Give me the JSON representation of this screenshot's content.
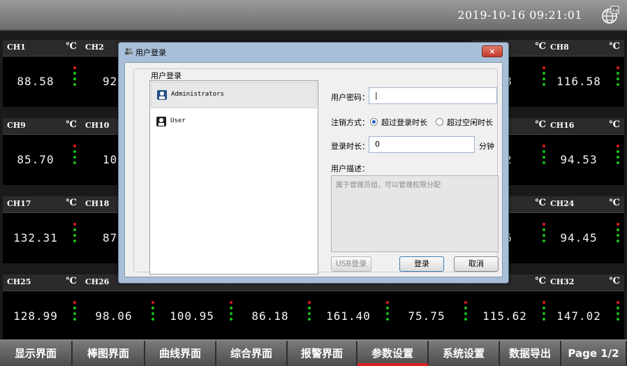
{
  "header": {
    "datetime": "2019-10-16  09:21:01",
    "globe_icon": "globe-icon"
  },
  "unit": "℃",
  "rows": [
    {
      "cells": [
        {
          "name": "CH1",
          "value": "88.58",
          "col": 0
        },
        {
          "name": "CH2",
          "value": "92.",
          "col": 1
        },
        {
          "name": "",
          "value": "58",
          "col": 6
        },
        {
          "name": "CH8",
          "value": "116.58",
          "col": 7
        }
      ]
    },
    {
      "cells": [
        {
          "name": "CH9",
          "value": "85.70",
          "col": 0
        },
        {
          "name": "CH10",
          "value": "104",
          "col": 1
        },
        {
          "name": "",
          "value": "52",
          "col": 6
        },
        {
          "name": "CH16",
          "value": "94.53",
          "col": 7
        }
      ]
    },
    {
      "cells": [
        {
          "name": "CH17",
          "value": "132.31",
          "col": 0
        },
        {
          "name": "CH18",
          "value": "87.",
          "col": 1
        },
        {
          "name": "",
          "value": "76",
          "col": 6
        },
        {
          "name": "CH24",
          "value": "94.45",
          "col": 7
        }
      ]
    },
    {
      "cells": [
        {
          "name": "CH25",
          "value": "128.99",
          "col": 0
        },
        {
          "name": "CH26",
          "value": "98.06",
          "col": 1
        },
        {
          "name": "",
          "value": "100.95",
          "col": 2
        },
        {
          "name": "",
          "value": "86.18",
          "col": 3
        },
        {
          "name": "",
          "value": "161.40",
          "col": 4
        },
        {
          "name": "",
          "value": "75.75",
          "col": 5
        },
        {
          "name": "",
          "value": "115.62",
          "col": 6
        },
        {
          "name": "CH32",
          "value": "147.02",
          "col": 7
        }
      ]
    }
  ],
  "tabs": [
    "显示界面",
    "棒图界面",
    "曲线界面",
    "综合界面",
    "报警界面",
    "参数设置",
    "系统设置",
    "数据导出",
    "Page 1/2"
  ],
  "active_tab": "参数设置",
  "dialog": {
    "title": "用户登录",
    "close_label": "×",
    "group_label": "用户登录",
    "users": [
      "Administrators",
      "User"
    ],
    "password_label": "用户密码：",
    "password_value": "|",
    "logout_label": "注销方式：",
    "logout_options": [
      "超过登录时长",
      "超过空闲时长"
    ],
    "duration_label": "登录时长：",
    "duration_value": "0",
    "duration_unit": "分钟",
    "desc_label": "用户描述：",
    "desc_text": "属于管理员组，可以管理权限分配",
    "usb_button": "USB登录",
    "login_button": "登录",
    "cancel_button": "取消"
  },
  "colors": {
    "alarm_red": "#e21b1b",
    "ok_green": "#19c219",
    "active_tab_underline": "#e02020"
  }
}
